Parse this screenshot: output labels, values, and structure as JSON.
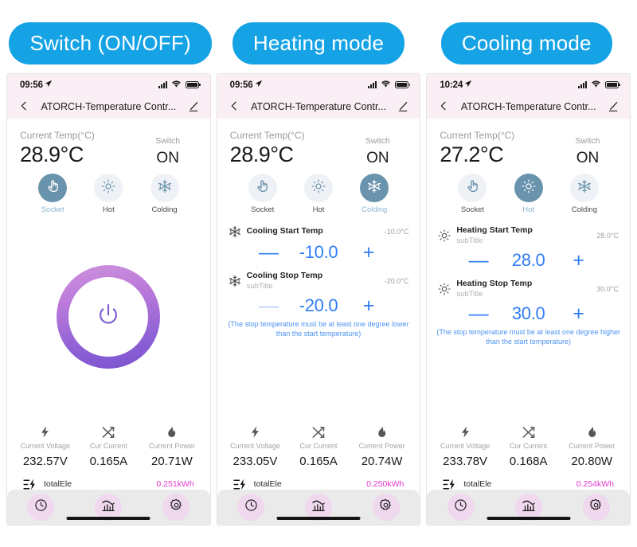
{
  "banners": [
    {
      "label": "Switch (ON/OFF)"
    },
    {
      "label": "Heating mode"
    },
    {
      "label": "Cooling mode"
    }
  ],
  "colors": {
    "banner_bg": "#16a3e6",
    "header_bg": "#f9eff5",
    "accent_blue": "#2f7cf6",
    "selected_mode": "#6a93ad",
    "total_pink": "#e637cf",
    "tab_circle": "#f0d8ee"
  },
  "phones": [
    {
      "statusbar": {
        "time": "09:56",
        "location_icon": "location-arrow-icon",
        "cellular_icon": "cellular-bars-icon",
        "wifi_icon": "wifi-icon",
        "battery_icon": "battery-full-icon"
      },
      "navbar": {
        "back_icon": "chevron-left-icon",
        "title": "ATORCH-Temperature Contr...",
        "edit_icon": "pencil-edit-icon"
      },
      "temp": {
        "label": "Current Temp(°C)",
        "value": "28.9°C"
      },
      "switch": {
        "label": "Switch",
        "value": "ON"
      },
      "modes": [
        {
          "label": "Socket",
          "icon": "hand-tap-icon",
          "selected": true
        },
        {
          "label": "Hot",
          "icon": "sun-icon",
          "selected": false
        },
        {
          "label": "Colding",
          "icon": "snowflake-icon",
          "selected": false
        }
      ],
      "content": "power",
      "power": {
        "icon": "power-icon"
      },
      "stats": [
        {
          "icon": "lightning-bolt-icon",
          "label": "Current Voltage",
          "value": "232.57V"
        },
        {
          "icon": "shuffle-arrows-icon",
          "label": "Cur Current",
          "value": "0.165A"
        },
        {
          "icon": "flame-icon",
          "label": "Current Power",
          "value": "20.71W"
        }
      ],
      "total": {
        "icon": "energy-meter-icon",
        "label": "totalEle",
        "value": "0.251kWh"
      },
      "tabs": [
        {
          "icon": "clock-icon"
        },
        {
          "icon": "chart-icon"
        },
        {
          "icon": "gear-icon"
        }
      ]
    },
    {
      "statusbar": {
        "time": "09:56",
        "location_icon": "location-arrow-icon",
        "cellular_icon": "cellular-bars-icon",
        "wifi_icon": "wifi-icon",
        "battery_icon": "battery-full-icon"
      },
      "navbar": {
        "back_icon": "chevron-left-icon",
        "title": "ATORCH-Temperature Contr...",
        "edit_icon": "pencil-edit-icon"
      },
      "temp": {
        "label": "Current Temp(°C)",
        "value": "28.9°C"
      },
      "switch": {
        "label": "Switch",
        "value": "ON"
      },
      "modes": [
        {
          "label": "Socket",
          "icon": "hand-tap-icon",
          "selected": false
        },
        {
          "label": "Hot",
          "icon": "sun-icon",
          "selected": false
        },
        {
          "label": "Colding",
          "icon": "snowflake-icon",
          "selected": true
        }
      ],
      "content": "settings",
      "settings": [
        {
          "icon": "snowflake-icon",
          "title": "Cooling Start Temp",
          "subtitle": "",
          "right": "-10.0°C",
          "minus": "—",
          "minus_disabled": false,
          "value": "-10.0",
          "plus": "+"
        },
        {
          "icon": "snowflake-icon",
          "title": "Cooling Stop Temp",
          "subtitle": "subTitle",
          "right": "-20.0°C",
          "minus": "—",
          "minus_disabled": true,
          "value": "-20.0",
          "plus": "+"
        }
      ],
      "hint": "(The stop temperature must be at least one degree lower than the start temperature)",
      "stats": [
        {
          "icon": "lightning-bolt-icon",
          "label": "Current Voltage",
          "value": "233.05V"
        },
        {
          "icon": "shuffle-arrows-icon",
          "label": "Cur Current",
          "value": "0.165A"
        },
        {
          "icon": "flame-icon",
          "label": "Current Power",
          "value": "20.74W"
        }
      ],
      "total": {
        "icon": "energy-meter-icon",
        "label": "totalEle",
        "value": "0.250kWh"
      },
      "tabs": [
        {
          "icon": "clock-icon"
        },
        {
          "icon": "chart-icon"
        },
        {
          "icon": "gear-icon"
        }
      ]
    },
    {
      "statusbar": {
        "time": "10:24",
        "location_icon": "location-arrow-icon",
        "cellular_icon": "cellular-bars-icon",
        "wifi_icon": "wifi-icon",
        "battery_icon": "battery-full-icon"
      },
      "navbar": {
        "back_icon": "chevron-left-icon",
        "title": "ATORCH-Temperature Contr...",
        "edit_icon": "pencil-edit-icon"
      },
      "temp": {
        "label": "Current Temp(°C)",
        "value": "27.2°C"
      },
      "switch": {
        "label": "Switch",
        "value": "ON"
      },
      "modes": [
        {
          "label": "Socket",
          "icon": "hand-tap-icon",
          "selected": false
        },
        {
          "label": "Hot",
          "icon": "sun-icon",
          "selected": true
        },
        {
          "label": "Colding",
          "icon": "snowflake-icon",
          "selected": false
        }
      ],
      "content": "settings",
      "settings": [
        {
          "icon": "sun-icon",
          "title": "Heating Start Temp",
          "subtitle": "subTitle",
          "right": "28.0°C",
          "minus": "—",
          "minus_disabled": false,
          "value": "28.0",
          "plus": "+"
        },
        {
          "icon": "sun-icon",
          "title": "Heating Stop Temp",
          "subtitle": "subTitle",
          "right": "30.0°C",
          "minus": "—",
          "minus_disabled": false,
          "value": "30.0",
          "plus": "+"
        }
      ],
      "hint": "(The stop temperature must be at least one degree higher than the start temperature)",
      "stats": [
        {
          "icon": "lightning-bolt-icon",
          "label": "Current Voltage",
          "value": "233.78V"
        },
        {
          "icon": "shuffle-arrows-icon",
          "label": "Cur Current",
          "value": "0.168A"
        },
        {
          "icon": "flame-icon",
          "label": "Current Power",
          "value": "20.80W"
        }
      ],
      "total": {
        "icon": "energy-meter-icon",
        "label": "totalEle",
        "value": "0.254kWh"
      },
      "tabs": [
        {
          "icon": "clock-icon"
        },
        {
          "icon": "chart-icon"
        },
        {
          "icon": "gear-icon"
        }
      ]
    }
  ]
}
